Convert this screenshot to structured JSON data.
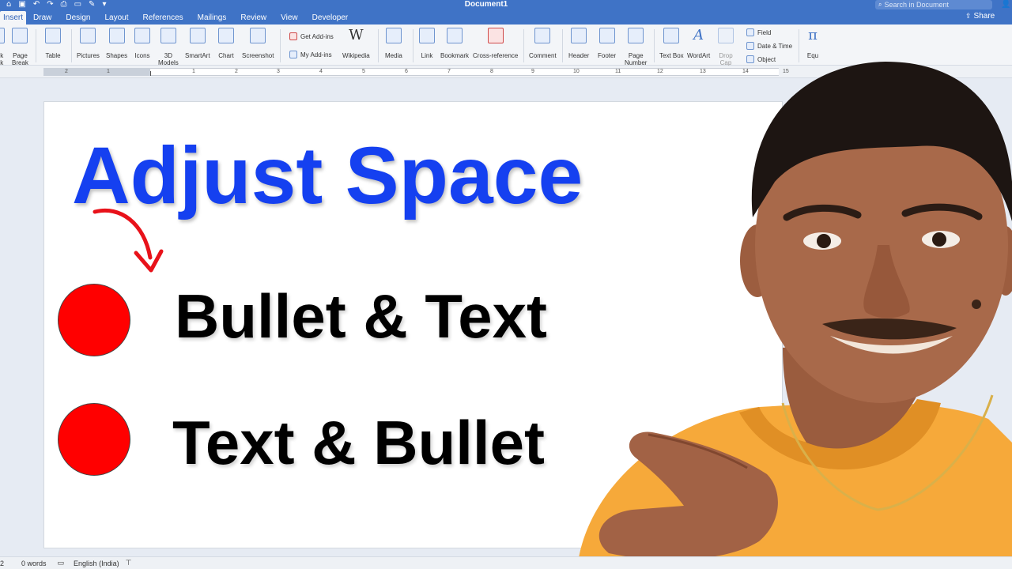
{
  "titlebar": {
    "document_title": "Document1",
    "search_placeholder": "Search in Document",
    "share_label": "Share"
  },
  "tabs": [
    "Insert",
    "Draw",
    "Design",
    "Layout",
    "References",
    "Mailings",
    "Review",
    "View",
    "Developer"
  ],
  "active_tab": "Insert",
  "ribbon": {
    "page_break_left": "ok",
    "page_break_left2": "ak",
    "page_break": "Page",
    "page_break2": "Break",
    "table": "Table",
    "pictures": "Pictures",
    "shapes": "Shapes",
    "icons": "Icons",
    "models": "3D",
    "models2": "Models",
    "smartart": "SmartArt",
    "chart": "Chart",
    "screenshot": "Screenshot",
    "get_addins": "Get Add-ins",
    "my_addins": "My Add-ins",
    "wikipedia": "Wikipedia",
    "media": "Media",
    "link": "Link",
    "bookmark": "Bookmark",
    "cross_reference": "Cross-reference",
    "comment": "Comment",
    "header": "Header",
    "footer": "Footer",
    "page_number": "Page",
    "page_number2": "Number",
    "text_box": "Text Box",
    "wordart": "WordArt",
    "drop_cap": "Drop",
    "drop_cap2": "Cap",
    "field": "Field",
    "date_time": "Date & Time",
    "object": "Object",
    "equation": "Equ"
  },
  "ruler": {
    "numbers": [
      "2",
      "1",
      "1",
      "2",
      "3",
      "4",
      "5",
      "6",
      "7",
      "8",
      "9",
      "10",
      "11",
      "12",
      "13",
      "14",
      "15"
    ]
  },
  "document": {
    "headline": "Adjust Space",
    "bullets": [
      {
        "text": "Bullet & Text"
      },
      {
        "text": "Text & Bullet"
      }
    ],
    "bullet_color": "#ff0000",
    "headline_color": "#1540f0"
  },
  "statusbar": {
    "page_indicator": "2",
    "word_count": "0 words",
    "language": "English (India)"
  },
  "colors": {
    "titlebar": "#3f73c6",
    "ribbon": "#f3f5f8"
  }
}
